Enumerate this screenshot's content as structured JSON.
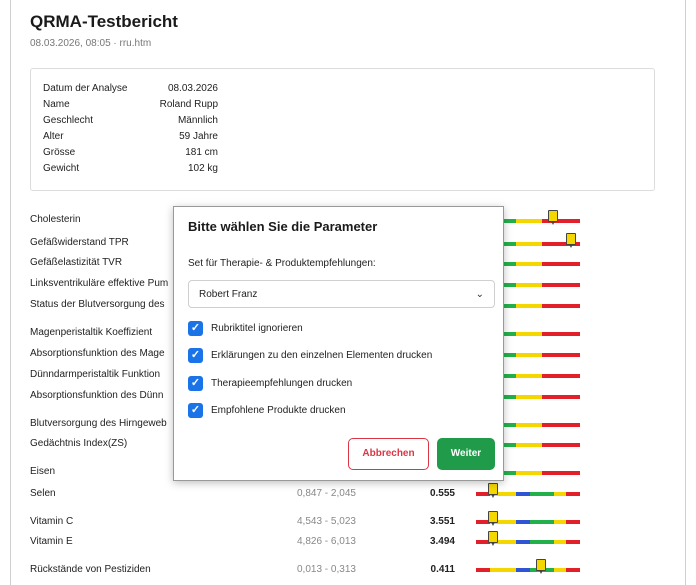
{
  "report": {
    "title": "QRMA-Testbericht",
    "subtitle": "08.03.2026, 08:05 · rru.htm"
  },
  "info": [
    {
      "key": "Datum der Analyse",
      "value": "08.03.2026"
    },
    {
      "key": "Name",
      "value": "Roland Rupp"
    },
    {
      "key": "Geschlecht",
      "value": "Männlich"
    },
    {
      "key": "Alter",
      "value": "59 Jahre"
    },
    {
      "key": "Grösse",
      "value": "181 cm"
    },
    {
      "key": "Gewicht",
      "value": "102 kg"
    }
  ],
  "parameters": [
    {
      "label": "Cholesterin",
      "range": "",
      "value": ""
    },
    {
      "label": "Gefäßwiderstand TPR",
      "range": "",
      "value": ""
    },
    {
      "label": "Gefäßelastizität TVR",
      "range": "",
      "value": ""
    },
    {
      "label": "Linksventrikuläre effektive Pum",
      "range": "",
      "value": ""
    },
    {
      "label": "Status der Blutversorgung des",
      "range": "",
      "value": ""
    },
    {
      "label": "Magenperistaltik Koeffizient",
      "range": "",
      "value": ""
    },
    {
      "label": "Absorptionsfunktion des Mage",
      "range": "",
      "value": ""
    },
    {
      "label": "Dünndarmperistaltik Funktion",
      "range": "",
      "value": ""
    },
    {
      "label": "Absorptionsfunktion des Dünn",
      "range": "",
      "value": ""
    },
    {
      "label": "Blutversorgung des Hirngeweb",
      "range": "",
      "value": ""
    },
    {
      "label": "Gedächtnis Index(ZS)",
      "range": "",
      "value": ""
    },
    {
      "label": "Eisen",
      "range": "",
      "value": ""
    },
    {
      "label": "Selen",
      "range": "0,847 - 2,045",
      "value": "0.555"
    },
    {
      "label": "Vitamin C",
      "range": "4,543 - 5,023",
      "value": "3.551"
    },
    {
      "label": "Vitamin E",
      "range": "4,826 - 6,013",
      "value": "3.494"
    },
    {
      "label": "Rückstände von Pestiziden",
      "range": "0,013 - 0,313",
      "value": "0.411"
    }
  ],
  "gauge_colors": {
    "red": "#e2202a",
    "yellow": "#f5d700",
    "blue": "#2f55d4",
    "green": "#22b04a"
  },
  "modal": {
    "title": "Bitte wählen Sie die Parameter",
    "set_label": "Set für Therapie- & Produktempfehlungen:",
    "select_value": "Robert Franz",
    "select_icon": "chevron-down-icon",
    "checks": [
      {
        "label": "Rubriktitel ignorieren",
        "checked": true
      },
      {
        "label": "Erklärungen zu den einzelnen Elementen drucken",
        "checked": true
      },
      {
        "label": "Therapieempfehlungen drucken",
        "checked": true
      },
      {
        "label": "Empfohlene Produkte drucken",
        "checked": true
      }
    ],
    "cancel_label": "Abbrechen",
    "next_label": "Weiter",
    "cancel_color": "#dc3545",
    "next_color": "#1f9b4a"
  }
}
